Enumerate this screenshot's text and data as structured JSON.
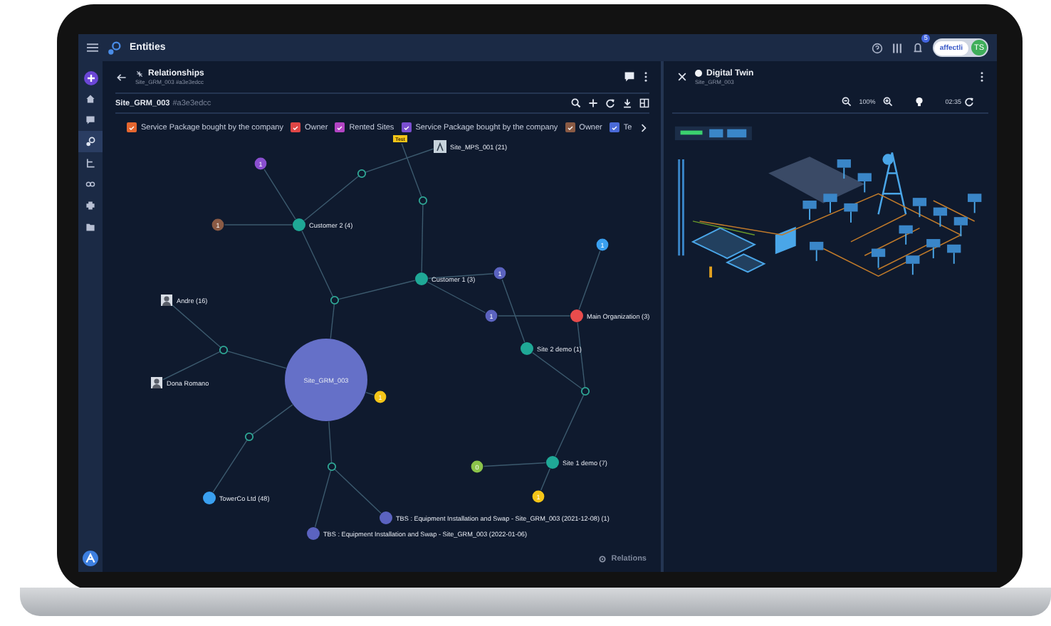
{
  "header": {
    "title": "Entities",
    "notification_count": "5",
    "logo": "affectli",
    "avatar": "TS"
  },
  "sidebar": {
    "items": [
      {
        "kind": "add",
        "selected": false
      },
      {
        "kind": "home",
        "selected": false
      },
      {
        "kind": "chat",
        "selected": false
      },
      {
        "kind": "entities",
        "selected": true
      },
      {
        "kind": "tree",
        "selected": false
      },
      {
        "kind": "link",
        "selected": false
      },
      {
        "kind": "print",
        "selected": false
      },
      {
        "kind": "folder",
        "selected": false
      }
    ]
  },
  "relationships": {
    "title": "Relationships",
    "subtitle": "Site_GRM_003 #a3e3edcc",
    "entity": "Site_GRM_003",
    "entity_id": "#a3e3edcc",
    "legend": [
      {
        "label": "Service Package bought by the company",
        "color": "#e5662f",
        "checked": true
      },
      {
        "label": "Owner",
        "color": "#e04646",
        "checked": true
      },
      {
        "label": "Rented Sites",
        "color": "#b344c4",
        "checked": true
      },
      {
        "label": "Service Package bought by the company",
        "color": "#7a4fd0",
        "checked": true
      },
      {
        "label": "Owner",
        "color": "#8a5a44",
        "checked": true
      },
      {
        "label": "Te",
        "color": "#4a6ad8",
        "checked": true
      }
    ],
    "graph": {
      "nodes": [
        {
          "kind": "tag",
          "label": "Test",
          "color": "#f5c518"
        },
        {
          "kind": "site",
          "label": "Site_MPS_001 (21)"
        },
        {
          "kind": "count",
          "label": "1",
          "color": "#8a4fcf"
        },
        {
          "kind": "count",
          "label": "1",
          "color": "#8a5a44"
        },
        {
          "kind": "entity",
          "label": "Customer 2 (4)",
          "color": "#1fa896"
        },
        {
          "kind": "count",
          "label": "1",
          "color": "#3aa0f0"
        },
        {
          "kind": "count",
          "label": "1",
          "color": "#5b63c0"
        },
        {
          "kind": "entity",
          "label": "Customer 1 (3)",
          "color": "#1fa896"
        },
        {
          "kind": "person",
          "label": "Andre (16)"
        },
        {
          "kind": "count",
          "label": "1",
          "color": "#5b63c0"
        },
        {
          "kind": "entity",
          "label": "Main Organization (3)",
          "color": "#e84c4c"
        },
        {
          "kind": "entity",
          "label": "Site 2 demo (1)",
          "color": "#1fa896"
        },
        {
          "kind": "person",
          "label": "Dona Romano"
        },
        {
          "kind": "root",
          "label": "Site_GRM_003",
          "color": "#6570c8"
        },
        {
          "kind": "count",
          "label": "1",
          "color": "#f5c518"
        },
        {
          "kind": "entity",
          "label": "Site 1 demo (7)",
          "color": "#1fa896"
        },
        {
          "kind": "count",
          "label": "0",
          "color": "#8bc34a"
        },
        {
          "kind": "count",
          "label": "1",
          "color": "#f5c518"
        },
        {
          "kind": "entity",
          "label": "TowerCo Ltd (48)",
          "color": "#3aa0f0"
        },
        {
          "kind": "entity",
          "label": "TBS : Equipment Installation and Swap - Site_GRM_003 (2021-12-08) (1)",
          "color": "#5b63c0"
        },
        {
          "kind": "entity",
          "label": "TBS : Equipment Installation and Swap - Site_GRM_003 (2022-01-06)",
          "color": "#5b63c0"
        }
      ]
    },
    "footer": "Relations"
  },
  "digital_twin": {
    "title": "Digital Twin",
    "subtitle": "Site_GRM_003",
    "zoom": "100%",
    "time": "02:35"
  }
}
